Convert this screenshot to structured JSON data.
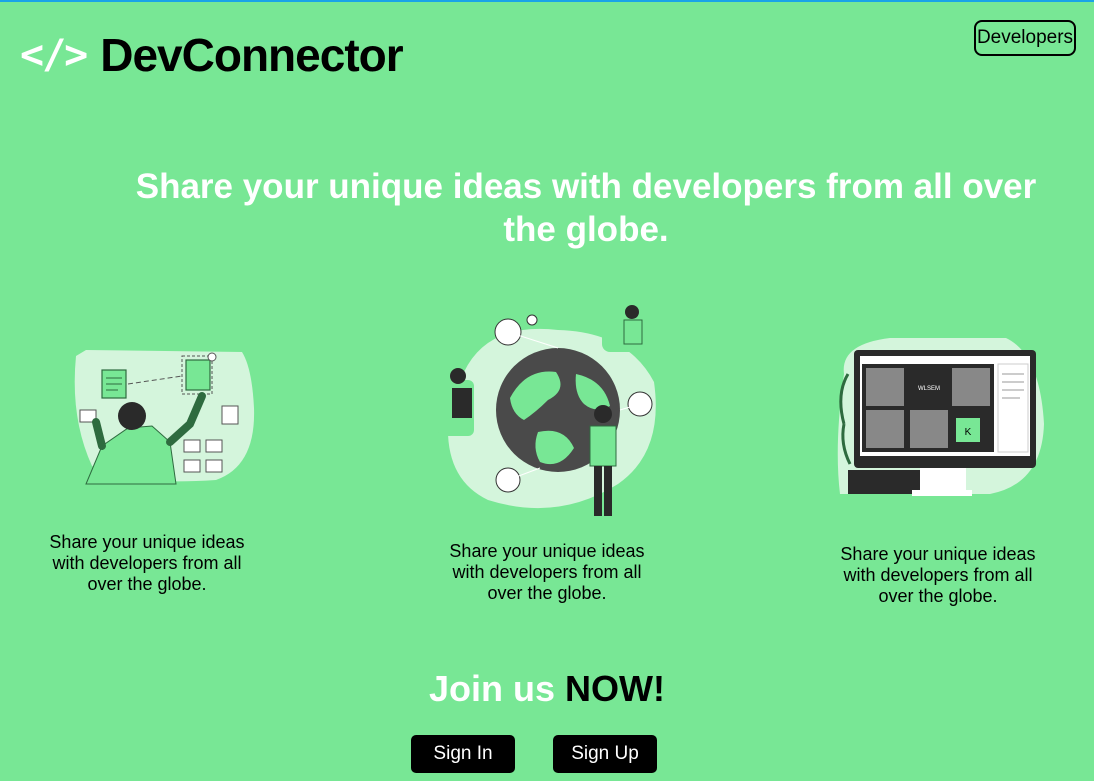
{
  "header": {
    "logo_icon": "</>",
    "logo_text": "DevConnector",
    "developers_label": "Developers"
  },
  "hero": {
    "title": "Share your unique ideas with developers from all over the globe."
  },
  "cards": [
    {
      "icon": "file-sharing-illustration",
      "caption": "Share your unique ideas with developers from all over the globe."
    },
    {
      "icon": "global-network-illustration",
      "caption": "Share your unique ideas with developers from all over the globe."
    },
    {
      "icon": "video-call-illustration",
      "caption": "Share your unique ideas with developers from all over the globe."
    }
  ],
  "join": {
    "text_white": "Join us",
    "text_black": "NOW!"
  },
  "buttons": {
    "sign_in": "Sign In",
    "sign_up": "Sign Up"
  },
  "illustration_text": {
    "monitor_label": "WLSEM",
    "tile_letter": "K"
  },
  "colors": {
    "background": "#78e795",
    "accent_light": "#d4f5dc",
    "button": "#000000"
  }
}
